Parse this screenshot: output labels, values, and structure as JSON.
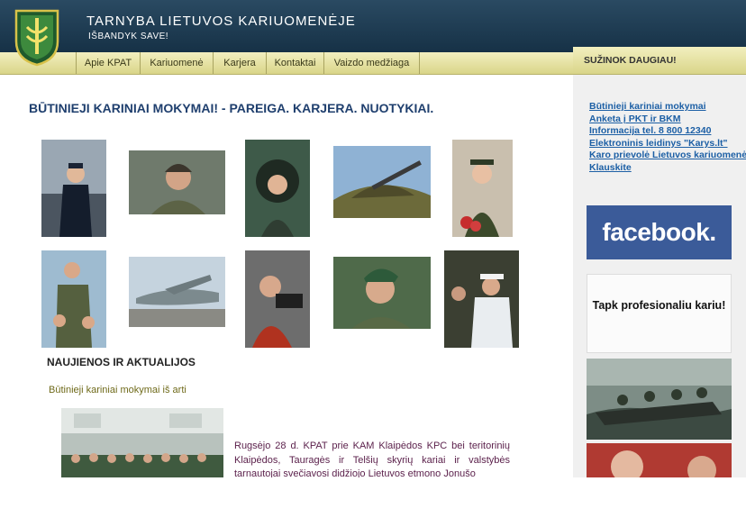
{
  "header": {
    "title": "TARNYBA LIETUVOS KARIUOMENĖJE",
    "subtitle": "IŠBANDYK SAVE!",
    "logo_icon": "military-shield-logo-icon"
  },
  "nav": {
    "items": [
      {
        "label": "Apie KPAT"
      },
      {
        "label": "Kariuomenė"
      },
      {
        "label": "Karjera"
      },
      {
        "label": "Kontaktai"
      },
      {
        "label": "Vaizdo medžiaga"
      }
    ]
  },
  "sidebar": {
    "heading": "SUŽINOK DAUGIAU!",
    "links": [
      "Būtinieji kariniai mokymai",
      "Anketa į PKT ir BKM",
      "Informacija tel. 8 800 12340",
      "Elektroninis leidinys \"Karys.lt\"",
      "Karo prievolė Lietuvos kariuomenė",
      "Klauskite"
    ],
    "facebook_label": "facebook.",
    "banner_text": "Tapk profesionaliu kariu!"
  },
  "main": {
    "title": "BŪTINIEJI KARINIAI MOKYMAI! - PAREIGA. KARJERA. NUOTYKIAI.",
    "photos": [
      "Sailor officer on ship deck",
      "Soldier in beanie and scarf",
      "Smiling soldier in vehicle hatch",
      "Camouflaged sniper with rifle",
      "Female cadet with flowers",
      "Soldier with children",
      "Military transport aircraft",
      "Cameraman filming",
      "Soldier in green beret",
      "Navy sailors in white caps"
    ],
    "news_heading": "NAUJIENOS IR AKTUALIJOS",
    "news_link": "Būtinieji kariniai mokymai iš arti",
    "news_text": "Rugsėjo 28 d. KPAT prie KAM Klaipėdos KPC bei teritorinių Klaipėdos, Tauragės ir Telšių skyrių kariai ir valstybės tarnautojai svečiavosi didžiojo Lietuvos etmono Jonušo"
  },
  "colors": {
    "header_bg": "#163146",
    "nav_bg": "#e6e3a6",
    "title_blue": "#1f3f6e",
    "link_blue": "#1c5fa5",
    "facebook_blue": "#3b5b99"
  }
}
